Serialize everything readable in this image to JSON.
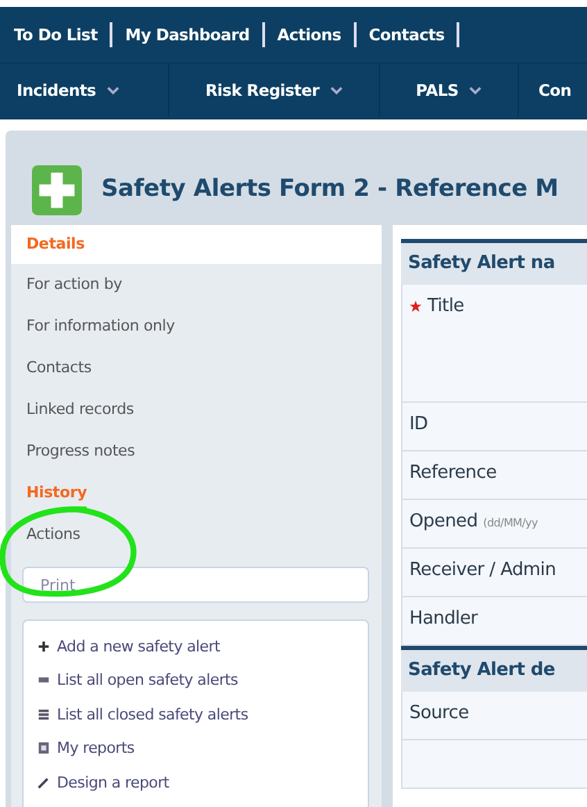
{
  "top_links": [
    "To Do List",
    "My Dashboard",
    "Actions",
    "Contacts"
  ],
  "modules": [
    {
      "label": "Incidents",
      "dropdown": true
    },
    {
      "label": "Risk Register",
      "dropdown": true
    },
    {
      "label": "PALS",
      "dropdown": true
    },
    {
      "label": "Con",
      "dropdown": false
    }
  ],
  "page_title": "Safety Alerts Form 2 - Reference M",
  "sidebar": {
    "items": [
      {
        "label": "Details",
        "kind": "heading",
        "selected": true
      },
      {
        "label": "For action by",
        "kind": "item",
        "selected": false
      },
      {
        "label": "For information only",
        "kind": "item",
        "selected": false
      },
      {
        "label": "Contacts",
        "kind": "item",
        "selected": false
      },
      {
        "label": "Linked records",
        "kind": "item",
        "selected": false
      },
      {
        "label": "Progress notes",
        "kind": "item",
        "selected": false
      },
      {
        "label": "History",
        "kind": "heading",
        "selected": false
      },
      {
        "label": "Actions",
        "kind": "item",
        "selected": false
      }
    ],
    "print": "Print",
    "actions": [
      {
        "label": "Add a new safety alert",
        "kind": "add"
      },
      {
        "label": "List all open safety alerts",
        "kind": "open"
      },
      {
        "label": "List all closed safety alerts",
        "kind": "closed"
      },
      {
        "label": "My reports",
        "kind": "reports"
      },
      {
        "label": "Design a report",
        "kind": "design"
      }
    ]
  },
  "form": {
    "sections": [
      {
        "title": "Safety Alert na",
        "fields": [
          {
            "label": "Title",
            "required": true,
            "tall": true
          },
          {
            "label": "ID",
            "required": false,
            "tall": false
          },
          {
            "label": "Reference",
            "required": false,
            "tall": false
          },
          {
            "label": "Opened",
            "hint": "(dd/MM/yy",
            "required": false,
            "tall": false
          },
          {
            "label": "Receiver / Admin",
            "required": false,
            "tall": false
          },
          {
            "label": "Handler",
            "required": false,
            "tall": false
          }
        ]
      },
      {
        "title": "Safety Alert de",
        "fields": [
          {
            "label": "Source",
            "required": false,
            "tall": false
          },
          {
            "required": false,
            "tall": false
          }
        ]
      }
    ]
  },
  "annotation": {
    "kind": "circle"
  }
}
